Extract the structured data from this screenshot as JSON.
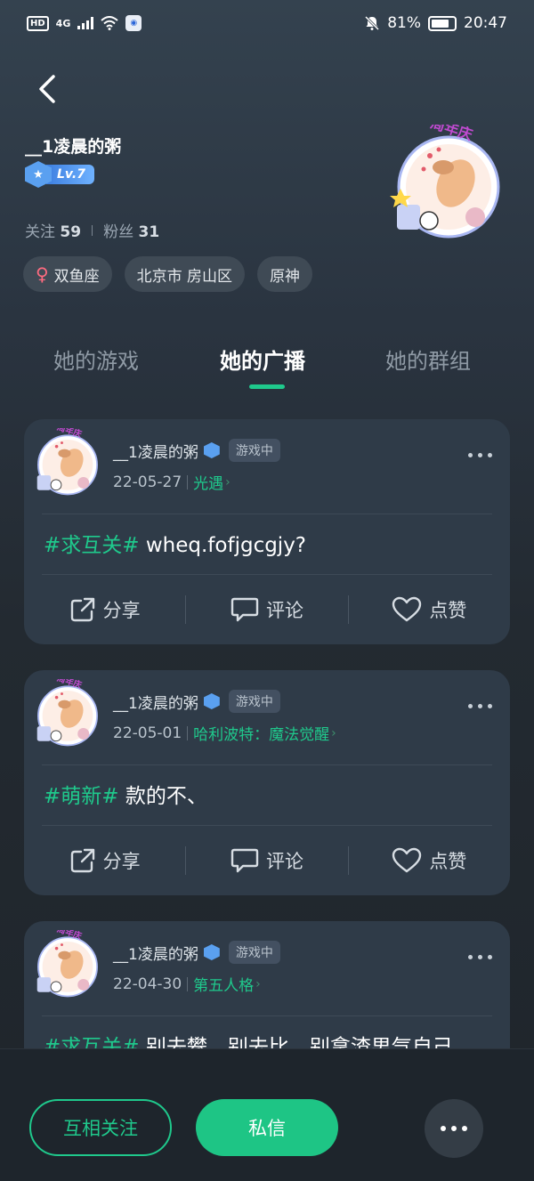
{
  "status_bar": {
    "hd": "HD",
    "network": "4G",
    "battery": "81%",
    "time": "20:47"
  },
  "profile": {
    "name": "__1凌晨的粥",
    "level": "Lv.7",
    "following_label": "关注",
    "following_count": "59",
    "followers_label": "粉丝",
    "followers_count": "31",
    "avatar_badge_text": "周年庆",
    "chips": [
      "双鱼座",
      "北京市 房山区",
      "原神"
    ]
  },
  "tabs": [
    {
      "label": "她的游戏",
      "active": false
    },
    {
      "label": "她的广播",
      "active": true
    },
    {
      "label": "她的群组",
      "active": false
    }
  ],
  "posts": [
    {
      "author": "__1凌晨的粥",
      "status": "游戏中",
      "date": "22-05-27",
      "game": "光遇",
      "tag": "#求互关#",
      "text": " wheq.fofjgcgjy?"
    },
    {
      "author": "__1凌晨的粥",
      "status": "游戏中",
      "date": "22-05-01",
      "game": "哈利波特：魔法觉醒",
      "tag": "#萌新#",
      "text": " 款的不、"
    },
    {
      "author": "__1凌晨的粥",
      "status": "游戏中",
      "date": "22-04-30",
      "game": "第五人格",
      "tag": "#求互关#",
      "text": " 别去攀，别去比，别拿渣男气自己"
    }
  ],
  "actions": {
    "share": "分享",
    "comment": "评论",
    "like": "点赞"
  },
  "bottom": {
    "follow_label": "互相关注",
    "message_label": "私信"
  },
  "colors": {
    "accent": "#1fc98c",
    "card": "#2f3b48",
    "background": "#232a31"
  }
}
